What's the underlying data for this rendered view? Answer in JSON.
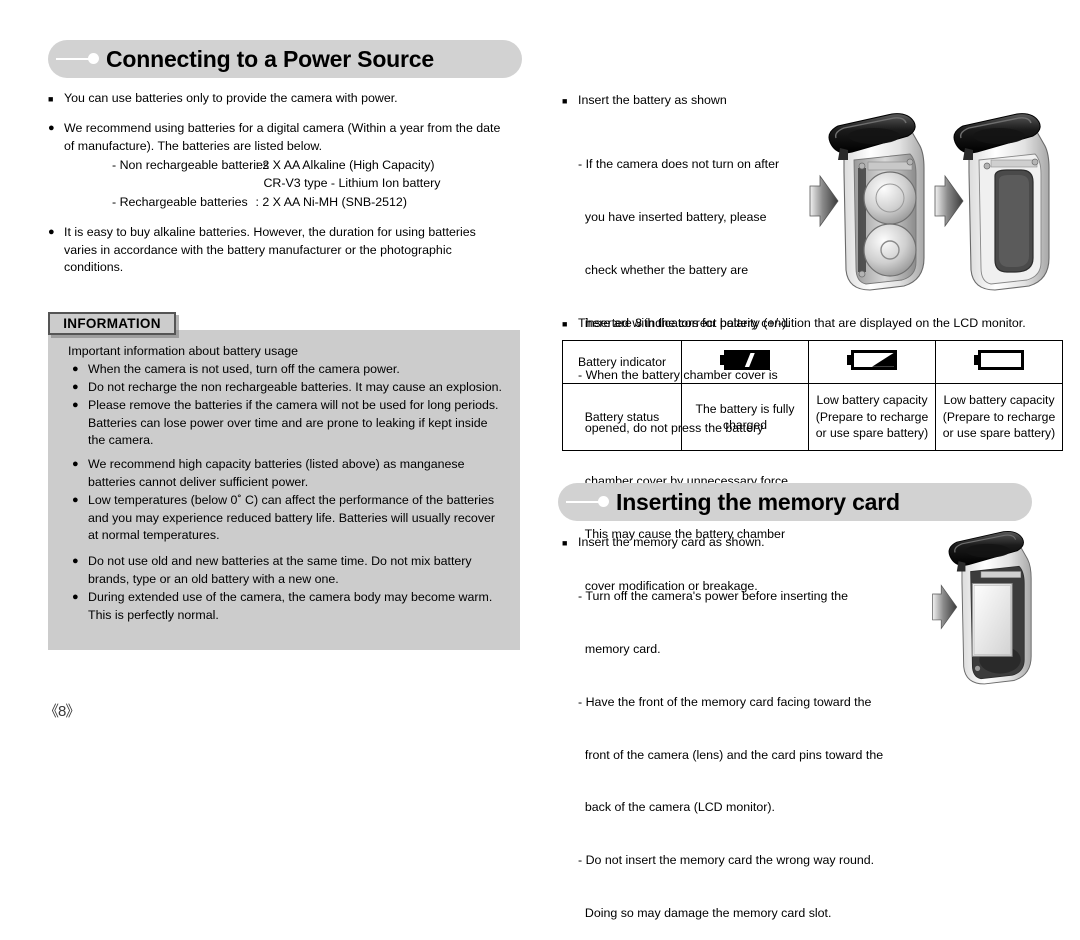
{
  "page": {
    "number": "《8》"
  },
  "sections": {
    "power": {
      "heading": "Connecting to a Power Source",
      "intro_bullet": "You can use batteries only to provide the camera with power.",
      "recommend_bullet_line1": "We recommend using batteries for a digital camera (Within a year from the date",
      "recommend_bullet_line2": "of manufacture). The batteries are listed below.",
      "battery_types": [
        {
          "label": "- Non rechargeable batteries",
          "value": ": 2 X AA Alkaline (High Capacity)"
        },
        {
          "label": "",
          "value": "CR-V3 type  - Lithium Ion battery"
        },
        {
          "label": "- Rechargeable batteries",
          "value": ": 2 X AA Ni-MH (SNB-2512)"
        }
      ],
      "alkaline_bullet_line1": "It is easy to buy alkaline batteries. However, the duration for using batteries",
      "alkaline_bullet_line2": "varies in accordance with the battery manufacturer or the photographic",
      "alkaline_bullet_line3": "conditions."
    },
    "information": {
      "tab_label": "INFORMATION",
      "subtitle": "Important information about battery usage",
      "items": [
        [
          "When the camera is not used, turn off the camera power."
        ],
        [
          "Do not recharge the non rechargeable batteries. It may cause an explosion."
        ],
        [
          "Please remove the batteries if the camera will not be used for long periods.",
          "Batteries can lose power over time and are prone to leaking if kept inside",
          "the camera."
        ],
        [
          "We recommend high capacity batteries (listed above) as manganese",
          "batteries cannot deliver sufficient power."
        ],
        [
          "Low temperatures (below 0˚ C) can affect the performance of the batteries",
          "and you may experience reduced battery life. Batteries will usually recover",
          "at normal temperatures."
        ],
        [
          "Do not use old and new batteries at the same time. Do not mix battery",
          "brands, type or an old battery with a new one."
        ],
        [
          "During extended use of the camera, the camera body may become warm.",
          "This is perfectly normal."
        ]
      ]
    },
    "insert_battery": {
      "heading_bullet": "Insert the battery as shown",
      "notes": [
        "- If the camera does not turn on after",
        "  you have inserted battery, please",
        "  check whether the battery are",
        "  inserted with the correct polarity (+/-).",
        "- When the battery chamber cover is",
        "  opened, do not press the battery",
        "  chamber cover by unnecessary force.",
        "  This may cause the battery chamber",
        "  cover modification or breakage."
      ]
    },
    "battery_indicator": {
      "intro": "There are 3 indicators for battery condition that are displayed on the LCD monitor.",
      "row_labels": {
        "indicator": "Battery indicator",
        "status": "Battery status"
      },
      "columns": [
        {
          "icon": "battery-full-icon",
          "status_lines": [
            "The battery is fully",
            "charged"
          ]
        },
        {
          "icon": "battery-low-icon",
          "status_lines": [
            "Low battery capacity",
            "(Prepare to recharge",
            "or use spare battery)"
          ]
        },
        {
          "icon": "battery-empty-icon",
          "status_lines": [
            "Low battery capacity",
            "(Prepare to recharge",
            "or use spare battery)"
          ]
        }
      ]
    },
    "memory_card": {
      "heading": "Inserting the memory card",
      "heading_bullet": "Insert the memory card as shown.",
      "notes": [
        "- Turn off the camera's power before inserting the",
        "  memory card.",
        "- Have the front of the memory card facing toward the",
        "  front of the camera (lens) and the card pins toward the",
        "  back of the camera (LCD monitor).",
        "- Do not insert the memory card the wrong way round.",
        "  Doing so may damage the memory card slot."
      ]
    }
  },
  "glyphs": {
    "square_bullet": "■",
    "round_bullet": "●"
  },
  "colors": {
    "pill_background": "#d2d2d2",
    "information_background": "#cccccc",
    "text": "#000000"
  }
}
